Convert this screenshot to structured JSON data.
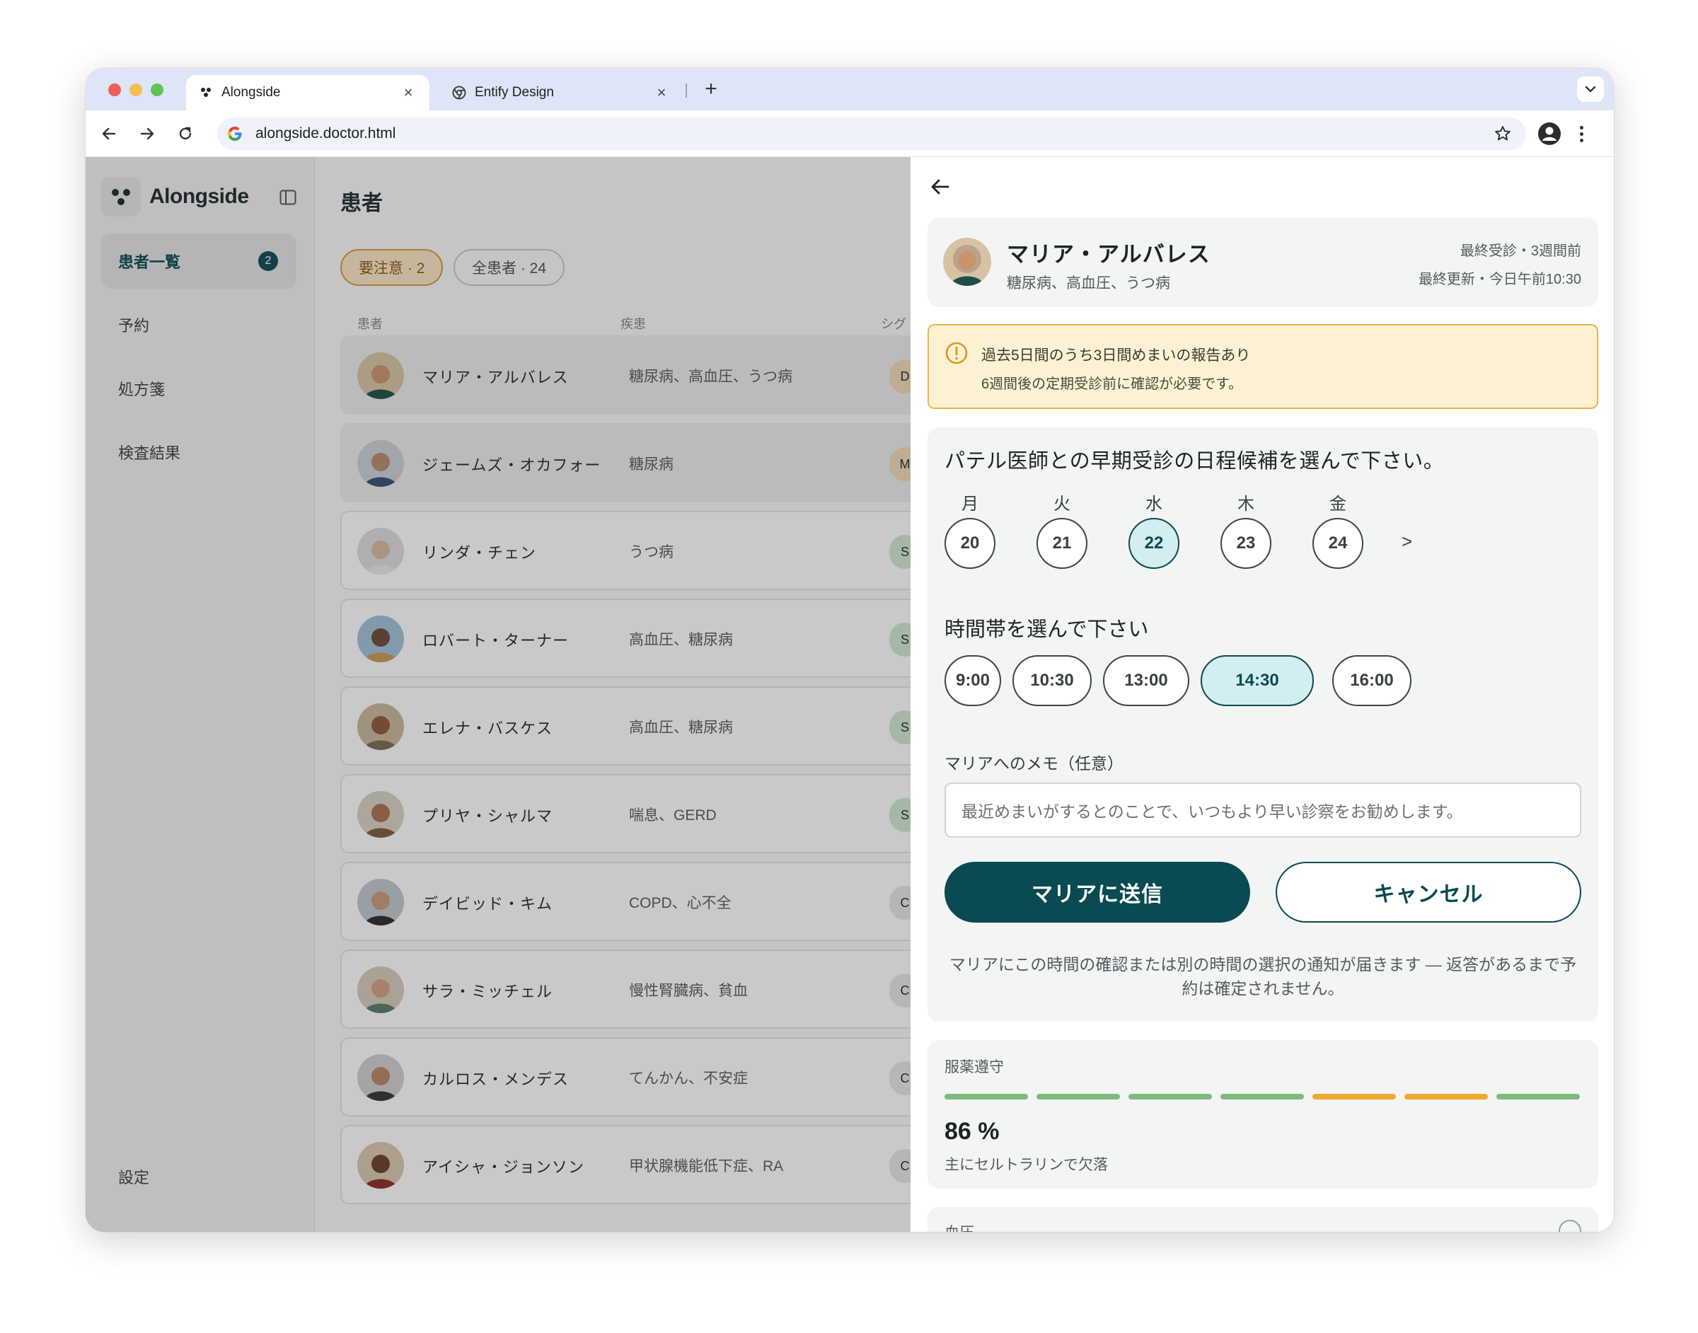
{
  "browser": {
    "tabs": [
      {
        "title": "Alongside",
        "active": true
      },
      {
        "title": "Entify Design",
        "active": false
      }
    ],
    "url": "alongside.doctor.html"
  },
  "sidebar": {
    "app_name": "Alongside",
    "items": [
      {
        "label": "患者一覧",
        "badge": "2",
        "active": true
      },
      {
        "label": "予約"
      },
      {
        "label": "処方箋"
      },
      {
        "label": "検査結果"
      }
    ],
    "settings": "設定"
  },
  "main": {
    "title": "患者",
    "filters": [
      {
        "label": "要注意 · 2",
        "active": true
      },
      {
        "label": "全患者 · 24",
        "active": false
      }
    ],
    "columns": [
      "患者",
      "疾患",
      "シグ"
    ],
    "patients": [
      {
        "name": "マリア・アルバレス",
        "conditions": "糖尿病、高血圧、うつ病",
        "signal": "D",
        "flagged": true,
        "signal_color": "#f3d9b6"
      },
      {
        "name": "ジェームズ・オカフォー",
        "conditions": "糖尿病",
        "signal": "M",
        "flagged": true,
        "signal_color": "#f3d9b6"
      },
      {
        "name": "リンダ・チェン",
        "conditions": "うつ病",
        "signal": "S",
        "flagged": false,
        "signal_color": "#cfe8cf"
      },
      {
        "name": "ロバート・ターナー",
        "conditions": "高血圧、糖尿病",
        "signal": "S",
        "flagged": false,
        "signal_color": "#cfe8cf"
      },
      {
        "name": "エレナ・バスケス",
        "conditions": "高血圧、糖尿病",
        "signal": "S",
        "flagged": false,
        "signal_color": "#cfe8cf"
      },
      {
        "name": "プリヤ・シャルマ",
        "conditions": "喘息、GERD",
        "signal": "S",
        "flagged": false,
        "signal_color": "#cfe8cf"
      },
      {
        "name": "デイビッド・キム",
        "conditions": "COPD、心不全",
        "signal": "C",
        "flagged": false,
        "signal_color": "#e6e6e6"
      },
      {
        "name": "サラ・ミッチェル",
        "conditions": "慢性腎臓病、貧血",
        "signal": "C",
        "flagged": false,
        "signal_color": "#e6e6e6"
      },
      {
        "name": "カルロス・メンデス",
        "conditions": "てんかん、不安症",
        "signal": "C",
        "flagged": false,
        "signal_color": "#e6e6e6"
      },
      {
        "name": "アイシャ・ジョンソン",
        "conditions": "甲状腺機能低下症、RA",
        "signal": "C",
        "flagged": false,
        "signal_color": "#e6e6e6"
      }
    ]
  },
  "detail": {
    "patient_name": "マリア・アルバレス",
    "patient_conditions": "糖尿病、高血圧、うつ病",
    "last_visit": "最終受診・3週間前",
    "last_update": "最終更新・今日午前10:30",
    "alert": {
      "title": "過去5日間のうち3日間めまいの報告あり",
      "subtitle": "6週間後の定期受診前に確認が必要です。"
    },
    "schedule_title": "パテル医師との早期受診の日程候補を選んで下さい。",
    "days": [
      {
        "dow": "月",
        "date": "20",
        "selected": false
      },
      {
        "dow": "火",
        "date": "21",
        "selected": false
      },
      {
        "dow": "水",
        "date": "22",
        "selected": true
      },
      {
        "dow": "木",
        "date": "23",
        "selected": false
      },
      {
        "dow": "金",
        "date": "24",
        "selected": false
      }
    ],
    "next_label": ">",
    "time_title": "時間帯を選んで下さい",
    "slots": [
      {
        "time": "9:00",
        "selected": false
      },
      {
        "time": "10:30",
        "selected": false
      },
      {
        "time": "13:00",
        "selected": false
      },
      {
        "time": "14:30",
        "selected": true
      },
      {
        "time": "16:00",
        "selected": false
      }
    ],
    "memo_label": "マリアへのメモ（任意）",
    "memo_value": "最近めまいがするとのことで、いつもより早い診察をお勧めします。",
    "send_label": "マリアに送信",
    "cancel_label": "キャンセル",
    "note": "マリアにこの時間の確認または別の時間の選択の通知が届きます — 返答があるまで予約は確定されません。",
    "adherence": {
      "label": "服薬遵守",
      "value": "86 %",
      "subtitle": "主にセルトラリンで欠落",
      "days": [
        "taken",
        "taken",
        "taken",
        "taken",
        "partial",
        "partial",
        "taken"
      ],
      "colors": {
        "taken": "#7dbb7d",
        "partial": "#efaa2e"
      }
    },
    "bp_label": "血圧"
  }
}
